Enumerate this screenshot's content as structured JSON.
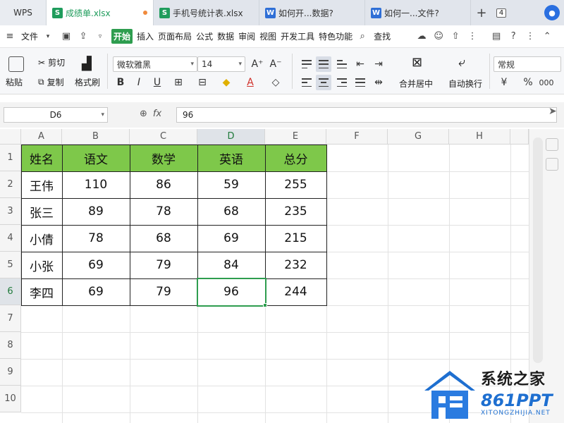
{
  "tabs": {
    "wps": "WPS",
    "items": [
      {
        "label": "成绩单.xlsx",
        "type": "S",
        "active": true
      },
      {
        "label": "手机号统计表.xlsx",
        "type": "S",
        "active": false
      },
      {
        "label": "如何开...数据?",
        "type": "W",
        "active": false
      },
      {
        "label": "如何一...文件?",
        "type": "W",
        "active": false
      }
    ],
    "count": "4",
    "plus": "+"
  },
  "menu": {
    "file": "文件",
    "items": [
      "开始",
      "插入",
      "页面布局",
      "公式",
      "数据",
      "审阅",
      "视图",
      "开发工具",
      "特色功能"
    ],
    "search": "查找"
  },
  "ribbon": {
    "paste": "粘贴",
    "cut": "剪切",
    "copy": "复制",
    "format_painter": "格式刷",
    "font_name": "微软雅黑",
    "font_size": "14",
    "merge_center": "合并居中",
    "wrap_text": "自动换行",
    "number_format": "常规",
    "bold": "B",
    "italic": "I",
    "underline": "U",
    "percent": "%"
  },
  "formula_bar": {
    "cell_ref": "D6",
    "fx": "fx",
    "value": "96"
  },
  "sheet": {
    "columns": [
      "A",
      "B",
      "C",
      "D",
      "E",
      "F",
      "G",
      "H"
    ],
    "rows": [
      "1",
      "2",
      "3",
      "4",
      "5",
      "6",
      "7",
      "8",
      "9",
      "10"
    ],
    "active_cell": "D6",
    "header": [
      "姓名",
      "语文",
      "数学",
      "英语",
      "总分"
    ],
    "data": [
      [
        "王伟",
        "110",
        "86",
        "59",
        "255"
      ],
      [
        "张三",
        "89",
        "78",
        "68",
        "235"
      ],
      [
        "小倩",
        "78",
        "68",
        "69",
        "215"
      ],
      [
        "小张",
        "69",
        "79",
        "84",
        "232"
      ],
      [
        "李四",
        "69",
        "79",
        "96",
        "244"
      ]
    ],
    "header_color": "#7ec84a",
    "selection_color": "#2e9d4f"
  },
  "watermark": {
    "title": "系统之家",
    "brand": "861PPT",
    "url": "XITONGZHIJIA.NET"
  }
}
